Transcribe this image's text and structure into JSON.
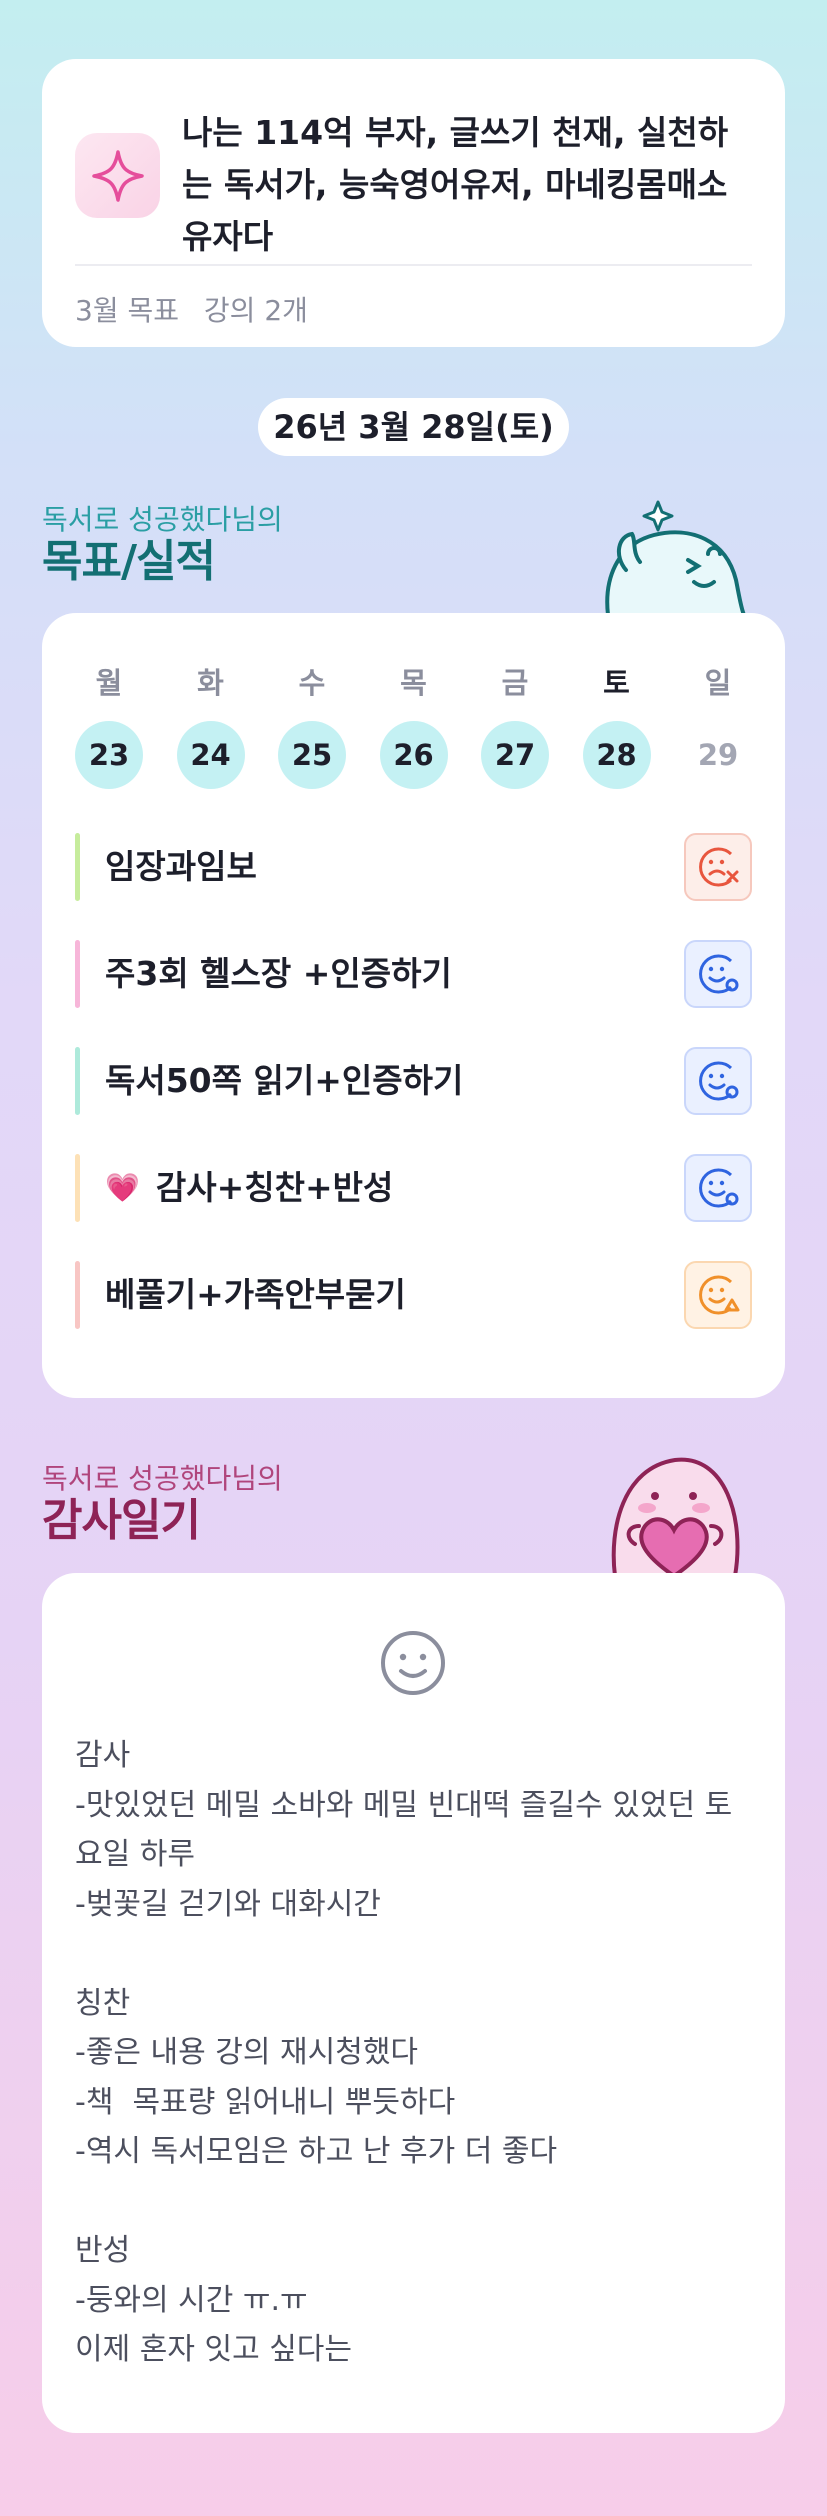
{
  "goal": {
    "title": "나는 114억 부자, 글쓰기 천재, 실천하는 독서가, 능숙영어유저, 마네킹몸매소유자다",
    "meta_month": "3월 목표",
    "meta_count": "강의 2개"
  },
  "date": "26년 3월 28일(토)",
  "routine_section": {
    "subtitle": "독서로 성공했다님의",
    "title": "목표/실적"
  },
  "week": [
    {
      "name": "월",
      "num": "23"
    },
    {
      "name": "화",
      "num": "24"
    },
    {
      "name": "수",
      "num": "25"
    },
    {
      "name": "목",
      "num": "26"
    },
    {
      "name": "금",
      "num": "27"
    },
    {
      "name": "토",
      "num": "28"
    },
    {
      "name": "일",
      "num": "29"
    }
  ],
  "tasks": [
    {
      "label": "임장과임보",
      "bar_color": "#c6ec9c",
      "status": "fail",
      "status_color": "#e8563e"
    },
    {
      "label": "주3회 헬스장 +인증하기",
      "bar_color": "#f7b6d9",
      "status": "success",
      "status_color": "#2f64e0"
    },
    {
      "label": "독서50쪽 읽기+인증하기",
      "bar_color": "#aeeadb",
      "status": "success",
      "status_color": "#2f64e0"
    },
    {
      "label": "감사+칭찬+반성",
      "emoji": "💗",
      "bar_color": "#fde1b6",
      "status": "success",
      "status_color": "#2f64e0"
    },
    {
      "label": "베풀기+가족안부묻기",
      "bar_color": "#f8c6c4",
      "status": "partial",
      "status_color": "#f0902a"
    }
  ],
  "diary_section": {
    "subtitle": "독서로 성공했다님의",
    "title": "감사일기"
  },
  "diary": {
    "mood_icon": "smile-face-icon",
    "text": "감사\n-맛있었던 메밀 소바와 메밀 빈대떡 즐길수 있었던 토요일 하루\n-벚꽃길 걷기와 대화시간\n\n칭찬\n-좋은 내용 강의 재시청했다\n-책  목표량 읽어내니 뿌듯하다\n-역시 독서모임은 하고 난 후가 더 좋다\n\n반성\n-둥와의 시간 ㅠ.ㅠ\n이제 혼자 잇고 싶다는"
  }
}
